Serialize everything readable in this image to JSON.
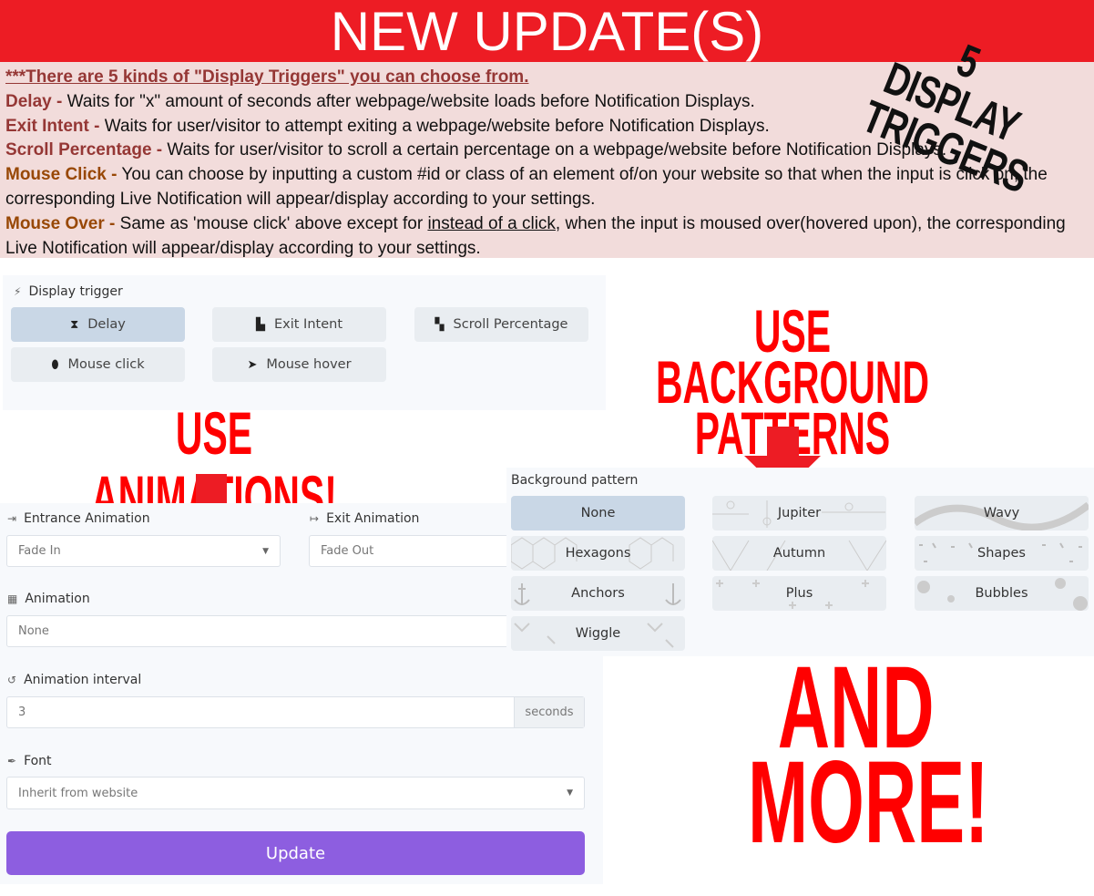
{
  "banner": {
    "title": "NEW UPDATE(S)"
  },
  "sticker": {
    "line1": "5 DISPLAY",
    "line2": "TRIGGERS"
  },
  "info": {
    "heading": "***There are 5 kinds of \"Display Triggers\" you can choose from.",
    "items": [
      {
        "term": "Delay -",
        "text": " Waits for \"x\" amount of seconds after webpage/website loads before Notification Displays."
      },
      {
        "term": "Exit Intent -",
        "text": " Waits for user/visitor to attempt exiting a webpage/website before Notification Displays."
      },
      {
        "term": "Scroll Percentage -",
        "text": " Waits for user/visitor to scroll a certain percentage on a webpage/website before Notification Displays."
      },
      {
        "term": "Mouse Click -",
        "text": " You can choose by inputting a custom #id or class of an element of/on your website so that when the input is click on, the corresponding Live Notification will appear/display according to your settings."
      },
      {
        "term": "Mouse Over -",
        "text_before": " Same as 'mouse click' above except for ",
        "underlined": "instead of a click",
        "text_after": ", when the input is moused over(hovered upon), the corresponding Live Notification will appear/display according to your settings."
      }
    ]
  },
  "trigger": {
    "label": "Display trigger",
    "options": [
      "Delay",
      "Exit Intent",
      "Scroll Percentage",
      "Mouse click",
      "Mouse hover"
    ],
    "selected": "Delay"
  },
  "callouts": {
    "animations": "USE ANIMATIONS!",
    "patterns1": "USE BACKGROUND",
    "patterns2": "PATTERNS",
    "more1": "AND",
    "more2": "MORE!"
  },
  "form": {
    "entrance_label": "Entrance Animation",
    "entrance_value": "Fade In",
    "exit_label": "Exit Animation",
    "exit_value": "Fade Out",
    "animation_label": "Animation",
    "animation_value": "None",
    "interval_label": "Animation interval",
    "interval_value": "3",
    "interval_unit": "seconds",
    "font_label": "Font",
    "font_value": "Inherit from website",
    "update_label": "Update"
  },
  "patterns": {
    "label": "Background pattern",
    "options": [
      "None",
      "Jupiter",
      "Wavy",
      "Hexagons",
      "Autumn",
      "Shapes",
      "Anchors",
      "Plus",
      "Bubbles",
      "Wiggle"
    ],
    "selected": "None"
  },
  "colors": {
    "banner": "#ed1c24",
    "accent": "#8d5ee0",
    "callout": "#ff0000"
  }
}
